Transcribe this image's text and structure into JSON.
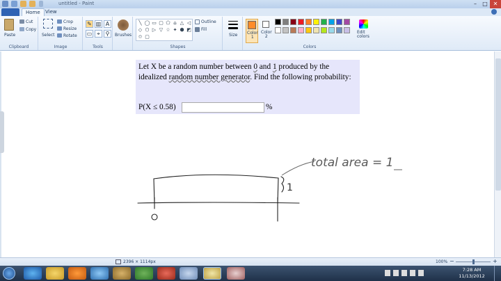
{
  "titlebar": {
    "title": "untitled - Paint",
    "min": "–",
    "max": "□",
    "close": "✕"
  },
  "tabs": {
    "file": "",
    "home": "Home",
    "view": "View"
  },
  "ribbon": {
    "clipboard": {
      "paste": "Paste",
      "cut": "Cut",
      "copy": "Copy",
      "label": "Clipboard"
    },
    "image": {
      "select": "Select",
      "crop": "Crop",
      "resize": "Resize",
      "rotate": "Rotate",
      "label": "Image"
    },
    "tools": {
      "pencil": "✎",
      "fill": "▥",
      "text": "A",
      "eraser": "▭",
      "picker": "⌖",
      "magnifier": "⚲",
      "label": "Tools"
    },
    "brushes": {
      "label": "Brushes"
    },
    "shapes": {
      "outline": "Outline",
      "fill": "Fill",
      "label": "Shapes",
      "icons": [
        "╲",
        "◯",
        "▭",
        "▢",
        "⬠",
        "⌂",
        "△",
        "◁",
        "◇",
        "⬡",
        "▷",
        "▽",
        "☆",
        "✦",
        "⬢",
        "◩",
        "✩",
        "▢"
      ]
    },
    "size": {
      "label": "Size"
    },
    "colors": {
      "color1": "Color\n1",
      "color2": "Color\n2",
      "edit": "Edit\ncolors",
      "label": "Colors",
      "color1_value": "#ff8c2a",
      "color2_value": "#ffffff",
      "palette": [
        "#000000",
        "#7f7f7f",
        "#880015",
        "#ed1c24",
        "#ff7f27",
        "#fff200",
        "#22b14c",
        "#00a2e8",
        "#3f48cc",
        "#a349a4",
        "#ffffff",
        "#c3c3c3",
        "#b97a57",
        "#ffaec9",
        "#ffc90e",
        "#efe4b0",
        "#b5e61d",
        "#99d9ea",
        "#7092be",
        "#c8bfe7"
      ]
    }
  },
  "question": {
    "line1_pre": "Let X be a random number between ",
    "zero": "0",
    "and": " and ",
    "one": "1",
    "line1_post": " produced by the idealized ",
    "rng": "random number generator",
    "tail": ". Find the following probability:",
    "prob_label": "P(X ≤ 0.58)",
    "input_value": "",
    "percent": "%"
  },
  "drawing": {
    "annotation": "total area = 1",
    "side_label": "1",
    "origin_label": "0"
  },
  "status": {
    "dimensions": "2396 × 1114px",
    "zoom": "100%",
    "zoom_minus": "−",
    "zoom_plus": "+"
  },
  "taskbar": {
    "time": "7:28 AM",
    "date": "11/13/2012"
  }
}
